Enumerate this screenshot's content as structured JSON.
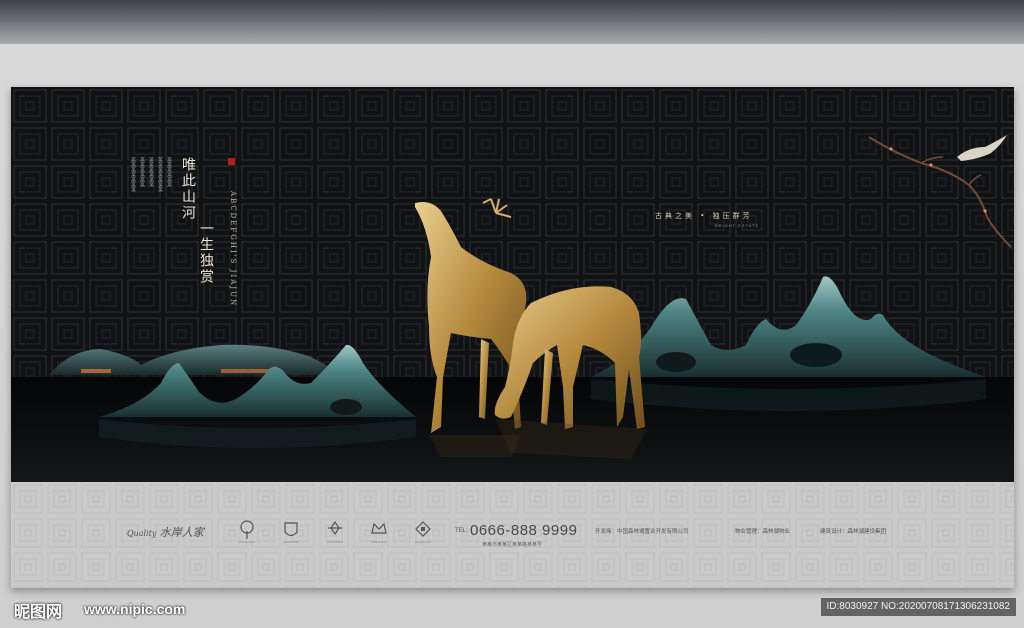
{
  "poster": {
    "main_title_right": "唯此山河",
    "main_title_left": "一生独赏",
    "english_vertical": "ABCDEFGHI'S  JIAJUN",
    "small_vertical_lines": [
      "某某某某某某某",
      "某某某某某某",
      "某某某某某某",
      "某某某某某某某",
      "某某某某某某"
    ],
    "tagline": "古典之美  •  独压群芳",
    "tagline_sub": "BRIGHT ESTATE",
    "colors": {
      "background": "#0c0d0f",
      "gold": "#c9a25a",
      "mountain": "#3d6e70",
      "strip": "#c9c9c9"
    }
  },
  "footer": {
    "brand_script": "Quality",
    "brand_name": "水岸人家",
    "logos": [
      "tree-logo-icon",
      "crest-logo-icon",
      "ornament-logo-icon",
      "crown-logo-icon",
      "diamond-logo-icon"
    ],
    "tel_label": "TEL:",
    "phone": "0666-888 9999",
    "address": "某某市某某区某某路某某号",
    "developer_label": "开发商：",
    "developer": "中国森林湖置业开发有限公司",
    "property_label": "物业管理：",
    "property": "森林湖物业",
    "builder_label": "建筑设计：",
    "builder": "森林湖建设集团"
  },
  "watermark": {
    "site_name": "昵图网",
    "url": "www.nipic.com",
    "id_text": "ID:8030927 NO:20200708171306231082"
  }
}
